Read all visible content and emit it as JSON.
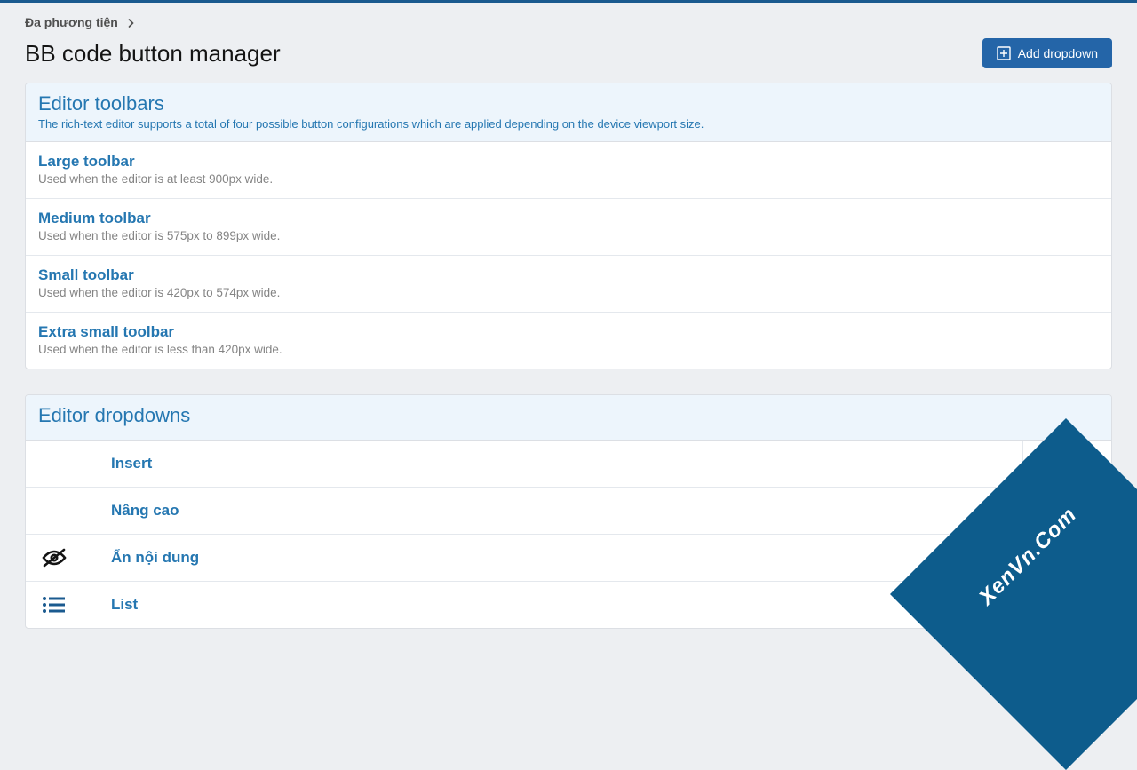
{
  "breadcrumb": {
    "label": "Đa phương tiện"
  },
  "header": {
    "title": "BB code button manager",
    "add_button": "Add dropdown"
  },
  "toolbars_panel": {
    "title": "Editor toolbars",
    "subtitle": "The rich-text editor supports a total of four possible button configurations which are applied depending on the device viewport size.",
    "items": [
      {
        "title": "Large toolbar",
        "desc": "Used when the editor is at least 900px wide."
      },
      {
        "title": "Medium toolbar",
        "desc": "Used when the editor is 575px to 899px wide."
      },
      {
        "title": "Small toolbar",
        "desc": "Used when the editor is 420px to 574px wide."
      },
      {
        "title": "Extra small toolbar",
        "desc": "Used when the editor is less than 420px wide."
      }
    ]
  },
  "dropdowns_panel": {
    "title": "Editor dropdowns",
    "items": [
      {
        "label": "Insert",
        "icon": "none",
        "toggle": true
      },
      {
        "label": "Nâng cao",
        "icon": "none",
        "toggle": true
      },
      {
        "label": "Ẩn nội dung",
        "icon": "eye-slash",
        "toggle": true
      },
      {
        "label": "List",
        "icon": "list",
        "toggle": true
      }
    ]
  },
  "watermark": "XenVn.Com"
}
